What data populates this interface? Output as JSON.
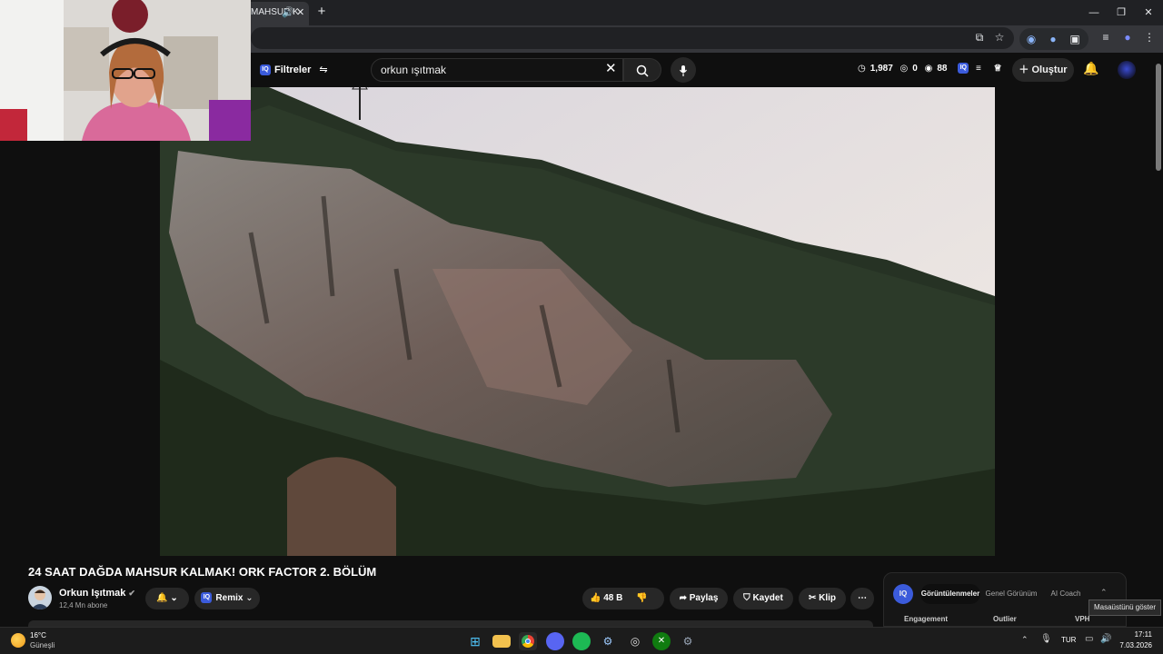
{
  "browser": {
    "tab_title": "MAHSUR K",
    "new_tab": "+",
    "window_controls": [
      "—",
      "❐",
      "✕"
    ]
  },
  "youtube": {
    "filters_label": "Filtreler",
    "iq_badge": "IQ",
    "search_value": "orkun ışıtmak",
    "stats": {
      "a": "1,987",
      "b": "0",
      "c": "88"
    },
    "create_label": "Oluştur"
  },
  "video": {
    "title": "24 SAAT DAĞDA MAHSUR KALMAK! ORK FACTOR 2. BÖLÜM",
    "channel": "Orkun Işıtmak",
    "subscribers": "12,4 Mn abone",
    "remix_label": "Remix",
    "likes": "48 B",
    "share_label": "Paylaş",
    "save_label": "Kaydet",
    "clip_label": "Klip"
  },
  "side_panel": {
    "tabs": [
      "Görüntülenmeler",
      "Genel Görünüm",
      "AI Coach"
    ],
    "columns": [
      "Engagement",
      "Outlier",
      "VPH"
    ]
  },
  "tooltip": "Masaüstünü göster",
  "taskbar": {
    "weather_temp": "16°C",
    "weather_desc": "Güneşli",
    "language": "TUR",
    "time": "17:11",
    "date": "7.03.2026"
  },
  "colors": {
    "page_bg": "#0f0f0f",
    "chrome_bg": "#202124",
    "toolbar_bg": "#35363a",
    "accent_iq": "#3b5bdb",
    "sky": "#e9e3e0"
  },
  "icons": [
    "speaker-icon",
    "close-icon",
    "cast-icon",
    "star-icon",
    "search-icon",
    "mic-icon",
    "bell-icon",
    "like-icon",
    "dislike-icon",
    "share-icon",
    "bookmark-icon",
    "scissors-icon",
    "more-icon",
    "windows-start-icon",
    "folder-icon",
    "chrome-icon",
    "discord-icon",
    "spotify-icon",
    "steam-icon",
    "xbox-icon",
    "settings-icon"
  ]
}
